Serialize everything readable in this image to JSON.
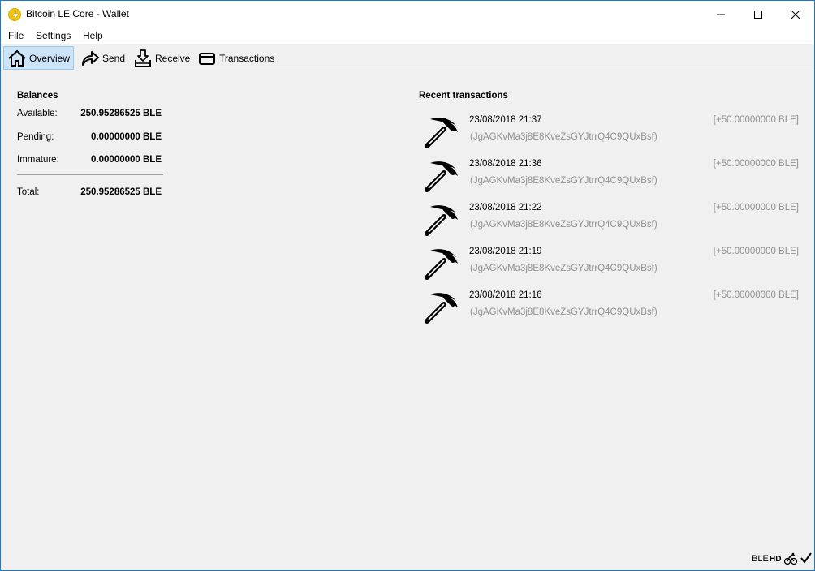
{
  "window": {
    "title": "Bitcoin LE Core - Wallet",
    "accent": "#1979ca"
  },
  "menu": {
    "file": "File",
    "settings": "Settings",
    "help": "Help"
  },
  "toolbar": {
    "overview": "Overview",
    "send": "Send",
    "receive": "Receive",
    "transactions": "Transactions"
  },
  "balances": {
    "title": "Balances",
    "available_label": "Available:",
    "available_value": "250.95286525 BLE",
    "pending_label": "Pending:",
    "pending_value": "0.00000000 BLE",
    "immature_label": "Immature:",
    "immature_value": "0.00000000 BLE",
    "total_label": "Total:",
    "total_value": "250.95286525 BLE"
  },
  "recent": {
    "title": "Recent transactions",
    "items": [
      {
        "icon": "pickaxe-icon",
        "date": "23/08/2018 21:37",
        "address": "(JgAGKvMa3j8E8KveZsGYJtrrQ4C9QUxBsf)",
        "amount": "[+50.00000000 BLE]"
      },
      {
        "icon": "pickaxe-icon",
        "date": "23/08/2018 21:36",
        "address": "(JgAGKvMa3j8E8KveZsGYJtrrQ4C9QUxBsf)",
        "amount": "[+50.00000000 BLE]"
      },
      {
        "icon": "pickaxe-icon",
        "date": "23/08/2018 21:22",
        "address": "(JgAGKvMa3j8E8KveZsGYJtrrQ4C9QUxBsf)",
        "amount": "[+50.00000000 BLE]"
      },
      {
        "icon": "pickaxe-icon",
        "date": "23/08/2018 21:19",
        "address": "(JgAGKvMa3j8E8KveZsGYJtrrQ4C9QUxBsf)",
        "amount": "[+50.00000000 BLE]"
      },
      {
        "icon": "pickaxe-icon",
        "date": "23/08/2018 21:16",
        "address": "(JgAGKvMa3j8E8KveZsGYJtrrQ4C9QUxBsf)",
        "amount": "[+50.00000000 BLE]"
      }
    ]
  },
  "statusbar": {
    "unit": "BLE",
    "hd": "HD"
  }
}
